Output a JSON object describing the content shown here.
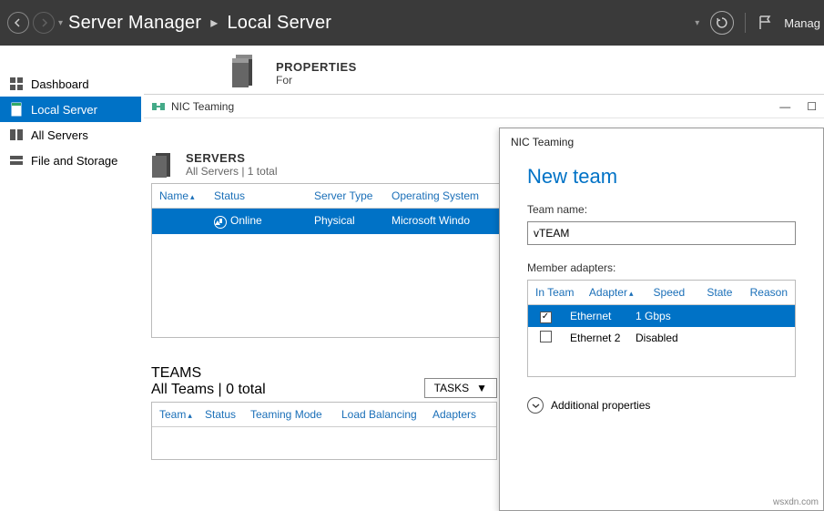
{
  "topbar": {
    "breadcrumb": [
      "Server Manager",
      "Local Server"
    ],
    "manage": "Manag"
  },
  "leftnav": {
    "items": [
      {
        "label": "Dashboard"
      },
      {
        "label": "Local Server"
      },
      {
        "label": "All Servers"
      },
      {
        "label": "File and Storage"
      }
    ]
  },
  "properties": {
    "title": "PROPERTIES",
    "sub": "For"
  },
  "nicWindow": {
    "title": "NIC Teaming",
    "servers": {
      "title": "SERVERS",
      "sub": "All Servers | 1 total",
      "columns": [
        "Name",
        "Status",
        "Server Type",
        "Operating System"
      ],
      "rows": [
        {
          "name": "",
          "status": "Online",
          "type": "Physical",
          "os": "Microsoft Windo"
        }
      ]
    },
    "teams": {
      "title": "TEAMS",
      "sub": "All Teams | 0 total",
      "tasks": "TASKS",
      "columns": [
        "Team",
        "Status",
        "Teaming Mode",
        "Load Balancing",
        "Adapters"
      ]
    }
  },
  "dialog": {
    "windowTitle": "NIC Teaming",
    "heading": "New team",
    "teamNameLabel": "Team name:",
    "teamNameValue": "vTEAM",
    "memberLabel": "Member adapters:",
    "columns": [
      "In Team",
      "Adapter",
      "Speed",
      "State",
      "Reason"
    ],
    "adapters": [
      {
        "checked": true,
        "adapter": "Ethernet",
        "speed": "1 Gbps",
        "state": "",
        "reason": ""
      },
      {
        "checked": false,
        "adapter": "Ethernet 2",
        "speed": "Disabled",
        "state": "",
        "reason": ""
      }
    ],
    "additional": "Additional properties"
  },
  "watermark": "wsxdn.com"
}
